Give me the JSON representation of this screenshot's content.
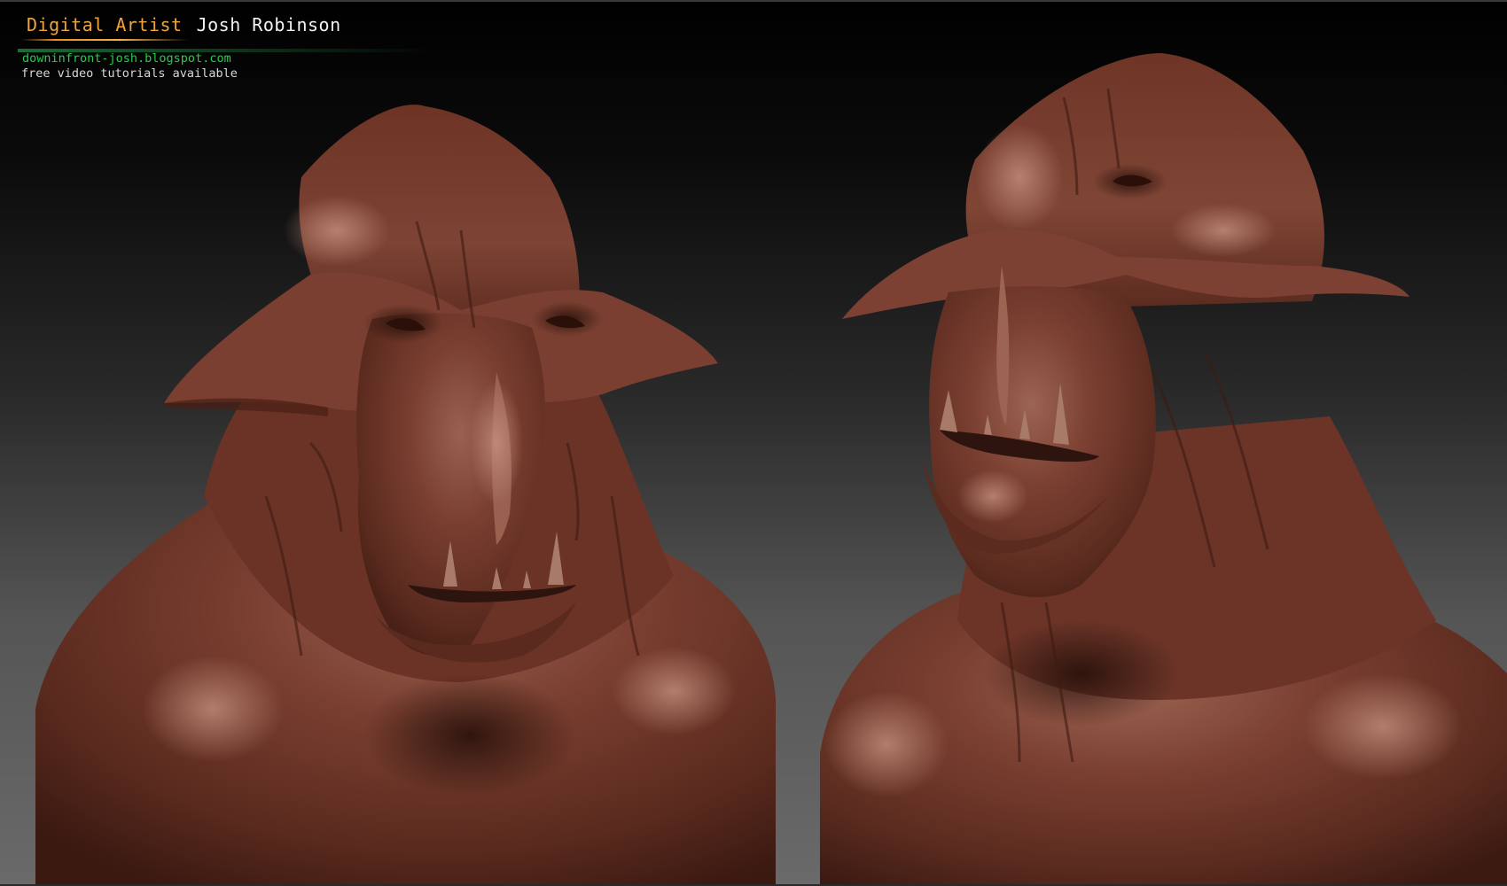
{
  "header": {
    "role": "Digital Artist",
    "name": "Josh Robinson",
    "blog_url": "downinfront-josh.blogspot.com",
    "tagline": "free video tutorials available"
  },
  "colors": {
    "sculpt_base": "#6b3427",
    "sculpt_mid": "#7d4333",
    "sculpt_highlight": "#a5705e",
    "sculpt_shadow": "#2e140e",
    "role_text": "#f0a33a",
    "link_text": "#22d04a"
  }
}
